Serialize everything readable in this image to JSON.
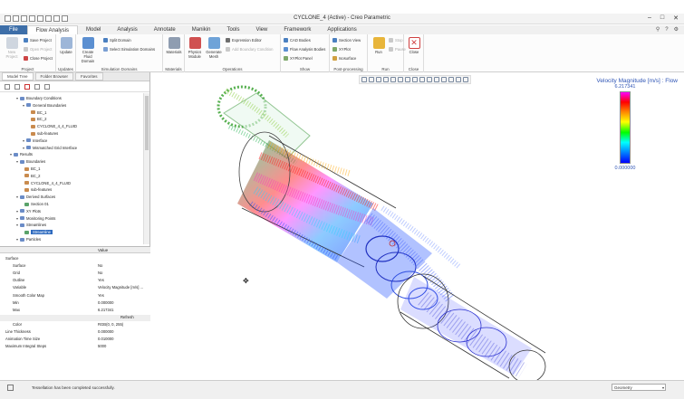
{
  "window": {
    "title": "CYCLONE_4 (Active) - Creo Parametric"
  },
  "tabs": [
    "File",
    "Flow Analysis",
    "Model",
    "Analysis",
    "Annotate",
    "Manikin",
    "Tools",
    "View",
    "Framework",
    "Applications"
  ],
  "ribbon": {
    "project": {
      "label": "Project",
      "new": "New Project",
      "save": "Save Project",
      "open": "Open Project",
      "close": "Close Project"
    },
    "updates": {
      "label": "Updates",
      "update": "Update"
    },
    "domains": {
      "label": "Simulation Domains",
      "create": "Create Fluid Domain",
      "split": "Split Domain",
      "select": "Select Simulation Domains"
    },
    "materials": {
      "label": "Materials",
      "materials": "Materials",
      "physics": "Physics Module",
      "mesh": "Generate Mesh"
    },
    "operations": {
      "label": "Operations",
      "expr": "Expression Editor",
      "addbc": "Add Boundary Condition"
    },
    "show": {
      "label": "Show",
      "cad": "CAD Bodies",
      "flow": "Flow Analysis Bodies",
      "xy": "XYPlot Panel"
    },
    "post": {
      "label": "Post-processing",
      "section": "Section View",
      "xyplot": "XYPlot",
      "iso": "Isosurface"
    },
    "run": {
      "label": "Run",
      "run": "Run",
      "stop": "Stop",
      "pause": "Pause"
    },
    "close": {
      "label": "Close",
      "close": "Close"
    }
  },
  "panel": {
    "tabs": [
      "Model Tree",
      "Folder Browser",
      "Favorites"
    ],
    "tree": [
      {
        "label": "Boundary Conditions",
        "depth": 2,
        "icon": "folder"
      },
      {
        "label": "General Boundaries",
        "depth": 3,
        "icon": "folder"
      },
      {
        "label": "BC_1",
        "depth": 4,
        "icon": "bc"
      },
      {
        "label": "BC_2",
        "depth": 4,
        "icon": "bc"
      },
      {
        "label": "CYCLONE_4_4_FLUID",
        "depth": 4,
        "icon": "bc"
      },
      {
        "label": "sub-features",
        "depth": 4,
        "icon": "bc"
      },
      {
        "label": "Interface",
        "depth": 3,
        "icon": "folder"
      },
      {
        "label": "Mismatched Grid Interface",
        "depth": 3,
        "icon": "folder"
      },
      {
        "label": "Results",
        "depth": 1,
        "icon": "folder"
      },
      {
        "label": "Boundaries",
        "depth": 2,
        "icon": "folder"
      },
      {
        "label": "BC_1",
        "depth": 3,
        "icon": "bc"
      },
      {
        "label": "BC_2",
        "depth": 3,
        "icon": "bc"
      },
      {
        "label": "CYCLONE_4_4_FLUID",
        "depth": 3,
        "icon": "bc"
      },
      {
        "label": "sub-features",
        "depth": 3,
        "icon": "bc"
      },
      {
        "label": "Derived Surfaces",
        "depth": 2,
        "icon": "folder"
      },
      {
        "label": "Section 01",
        "depth": 3,
        "icon": "sr"
      },
      {
        "label": "XY Plots",
        "depth": 2,
        "icon": "folder"
      },
      {
        "label": "Monitoring Points",
        "depth": 2,
        "icon": "folder"
      },
      {
        "label": "Streamlines",
        "depth": 2,
        "icon": "folder"
      },
      {
        "label": "Streamline",
        "depth": 3,
        "icon": "sr",
        "selected": true
      },
      {
        "label": "Particles",
        "depth": 2,
        "icon": "folder"
      }
    ],
    "props_header": {
      "name": "",
      "value": "Value"
    },
    "props": [
      {
        "k": "Surface",
        "v": "",
        "indent": 0
      },
      {
        "k": "Surface",
        "v": "No",
        "indent": 1
      },
      {
        "k": "Grid",
        "v": "No",
        "indent": 1
      },
      {
        "k": "Outline",
        "v": "Yes",
        "indent": 1
      },
      {
        "k": "Variable",
        "v": "Velocity Magnitude [m/s] ...",
        "indent": 1
      },
      {
        "k": "Smooth Color Map",
        "v": "Yes",
        "indent": 1
      },
      {
        "k": "Min",
        "v": "0.000000",
        "indent": 1
      },
      {
        "k": "Max",
        "v": "6.217341",
        "indent": 1
      },
      {
        "k": "",
        "v": "Refresh",
        "indent": 1,
        "hdr": true
      },
      {
        "k": "Color",
        "v": "RGB(0, 0, 255)",
        "indent": 1
      },
      {
        "k": "Line Thickness",
        "v": "0.000000",
        "indent": 0
      },
      {
        "k": "Animation Time Size",
        "v": "0.010000",
        "indent": 0
      },
      {
        "k": "Maximum Integral Steps",
        "v": "5000",
        "indent": 0
      }
    ]
  },
  "legend": {
    "title": "Velocity Magnitude [m/s] : Flow",
    "max": "6.217341",
    "min": "0.000000"
  },
  "status": {
    "message": "Tessellation has been completed successfully.",
    "filter": "Geometry"
  }
}
